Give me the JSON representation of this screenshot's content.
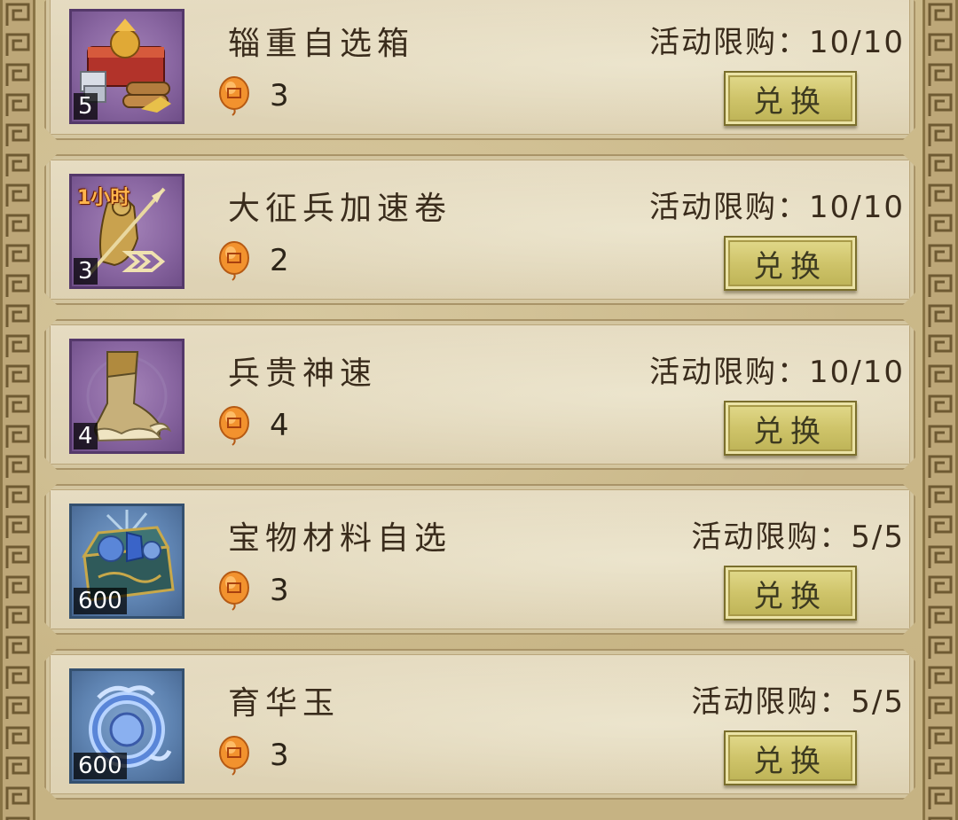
{
  "theme": {
    "accent_gold": "#cfc46a",
    "card_bg": "#e2d7bb",
    "rare_purple": "#8a67a2",
    "rare_blue": "#5f84b2",
    "cost_icon": "lantern-token-icon"
  },
  "items": [
    {
      "name": "辎重自选箱",
      "icon": "supply-chest-icon",
      "icon_quality": "purple",
      "quantity": "5",
      "time_tag": "",
      "cost": "3",
      "limit_label": "活动限购：10/10",
      "button_label": "兑换"
    },
    {
      "name": "大征兵加速卷",
      "icon": "recruit-speedup-scroll-icon",
      "icon_quality": "purple",
      "quantity": "3",
      "time_tag": "1小时",
      "cost": "2",
      "limit_label": "活动限购：10/10",
      "button_label": "兑换"
    },
    {
      "name": "兵贵神速",
      "icon": "march-boot-icon",
      "icon_quality": "purple",
      "quantity": "4",
      "time_tag": "",
      "cost": "4",
      "limit_label": "活动限购：10/10",
      "button_label": "兑换"
    },
    {
      "name": "宝物材料自选",
      "icon": "treasure-material-chest-icon",
      "icon_quality": "blue",
      "quantity": "600",
      "time_tag": "",
      "cost": "3",
      "limit_label": "活动限购：5/5",
      "button_label": "兑换"
    },
    {
      "name": "育华玉",
      "icon": "jade-dragon-icon",
      "icon_quality": "blue",
      "quantity": "600",
      "time_tag": "",
      "cost": "3",
      "limit_label": "活动限购：5/5",
      "button_label": "兑换"
    }
  ]
}
